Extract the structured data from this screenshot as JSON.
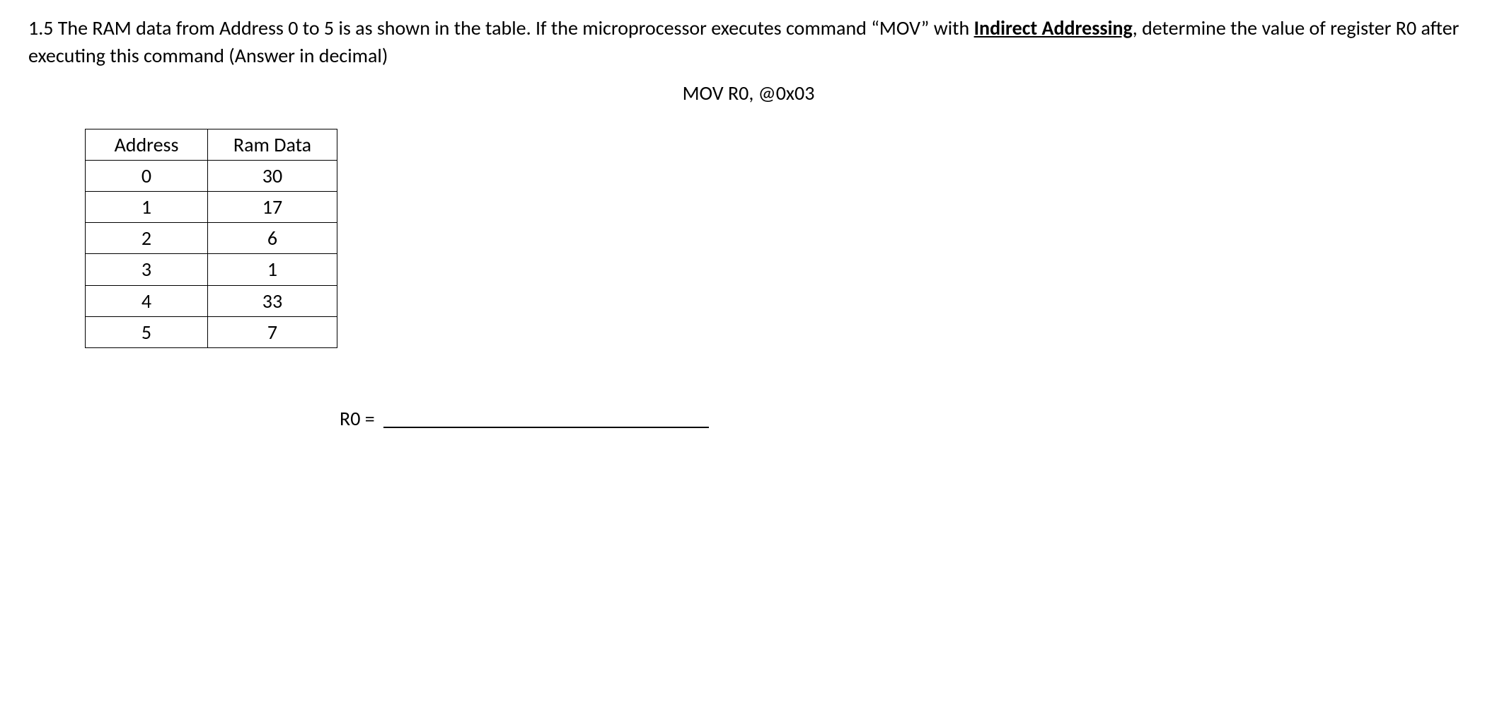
{
  "question": {
    "part1": "1.5 The RAM data from Address 0 to 5 is as shown in the table. If the microprocessor executes command “MOV” with ",
    "underlined": "Indirect Addressing",
    "part2": ", determine the value of register R0 after executing this command (Answer in decimal)"
  },
  "instruction": "MOV R0, @0x03",
  "table": {
    "headers": {
      "address": "Address",
      "data": "Ram Data"
    },
    "rows": [
      {
        "address": "0",
        "data": "30"
      },
      {
        "address": "1",
        "data": "17"
      },
      {
        "address": "2",
        "data": "6"
      },
      {
        "address": "3",
        "data": "1"
      },
      {
        "address": "4",
        "data": "33"
      },
      {
        "address": "5",
        "data": "7"
      }
    ]
  },
  "answer": {
    "label": "R0 =",
    "value": ""
  }
}
